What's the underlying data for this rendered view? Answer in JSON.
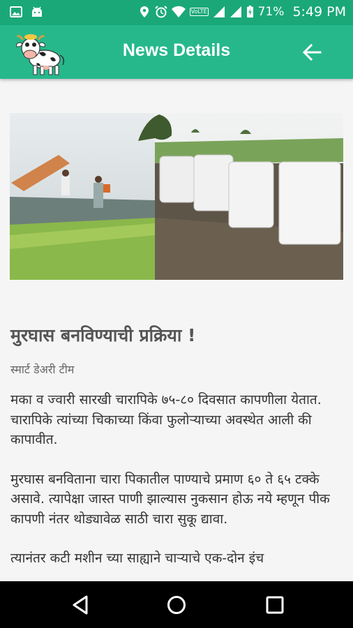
{
  "status_bar": {
    "battery": "71%",
    "time": "5:49 PM",
    "network": "VoLTE",
    "icons": [
      "image-icon",
      "android-icon",
      "location-icon",
      "alarm-icon",
      "wifi-icon",
      "signal-icon",
      "signal-icon",
      "battery-icon"
    ]
  },
  "app_bar": {
    "title": "News Details",
    "back_icon": "arrow-back-icon",
    "logo": "cow-logo"
  },
  "article": {
    "title": "मुरघास बनविण्याची प्रक्रिया !",
    "author": "स्मार्ट डेअरी टीम",
    "paragraphs": [
      "मका व ज्वारी सारखी चारापिके ७५-८० दिवसात कापणीला येतात.  चारापिके त्यांच्या चिकाच्या किंवा फुलोऱ्याच्या अवस्थेत आली की कापावीत.",
      "मुरघास बनविताना चारा पिकातील पाण्याचे प्रमाण ६० ते ६५ टक्के असावे.  त्यापेक्षा जास्त पाणी झाल्यास नुकसान होऊ नये म्हणून पीक कापणी नंतर थोड्यावेळ साठी चारा सुकू द्यावा.",
      "त्यानंतर कटी मशीन च्या साह्याने चाऱ्याचे एक-दोन इंच"
    ]
  },
  "nav_bar": {
    "icons": [
      "back-triangle-icon",
      "home-circle-icon",
      "recents-square-icon"
    ]
  },
  "colors": {
    "status_bar": "#1aa879",
    "app_bar": "#26b88b",
    "background": "#f5f5f5"
  }
}
